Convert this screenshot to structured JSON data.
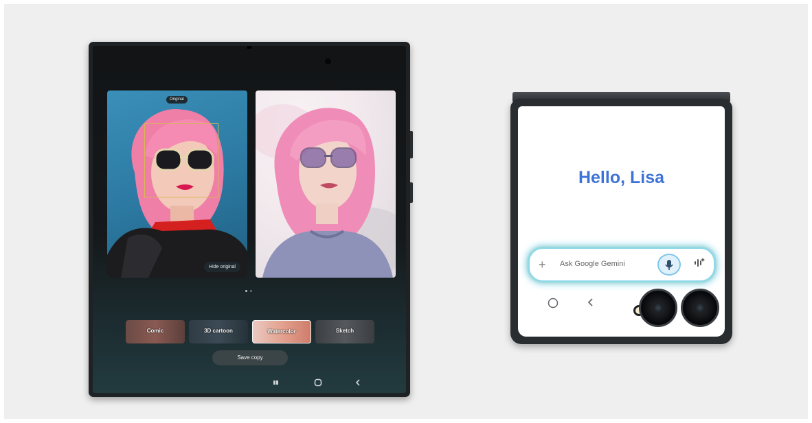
{
  "fold": {
    "original_badge": "Original",
    "hide_original_label": "Hide original",
    "styles": [
      {
        "label": "Comic"
      },
      {
        "label": "3D cartoon"
      },
      {
        "label": "Watercolor",
        "selected": true
      },
      {
        "label": "Sketch"
      }
    ],
    "save_copy_label": "Save copy",
    "page_indicator": {
      "pages": 2,
      "current": 1
    },
    "nav": {
      "recents_icon": "recents-icon",
      "home_icon": "home-icon",
      "back_icon": "back-icon"
    }
  },
  "flip": {
    "greeting": "Hello, Lisa",
    "gemini_placeholder": "Ask Google Gemini",
    "plus_icon": "plus-icon",
    "mic_icon": "mic-icon",
    "live_icon": "gemini-live-icon",
    "nav": {
      "home_icon": "home-icon",
      "back_icon": "back-icon"
    }
  },
  "colors": {
    "greeting": "#3d72d6",
    "accent_glow": "#8fd9e8"
  }
}
